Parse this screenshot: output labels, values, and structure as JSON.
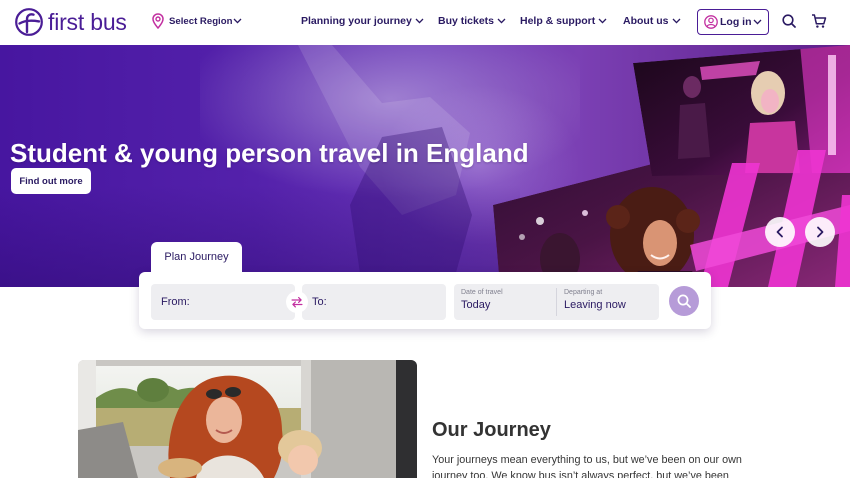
{
  "header": {
    "logo": {
      "text": "first bus",
      "icon": "logo-icon"
    },
    "region": {
      "label": "Select Region",
      "icon": "location-pin-icon"
    },
    "nav": [
      {
        "label": "Planning your journey",
        "icon": "chevron-down-icon"
      },
      {
        "label": "Buy tickets",
        "icon": "chevron-down-icon"
      },
      {
        "label": "Help & support",
        "icon": "chevron-down-icon"
      },
      {
        "label": "About us",
        "icon": "chevron-down-icon"
      }
    ],
    "login": {
      "label": "Log in",
      "icon": "user-icon"
    },
    "actions": [
      {
        "icon": "search-icon"
      },
      {
        "icon": "cart-icon"
      }
    ]
  },
  "hero": {
    "title": "Student & young person travel in England",
    "cta_label": "Find out more",
    "carousel": {
      "prev_icon": "chevron-left-icon",
      "next_icon": "chevron-right-icon"
    }
  },
  "planner": {
    "tab_label": "Plan Journey",
    "from_label": "From:",
    "swap_icon": "swap-icon",
    "to_label": "To:",
    "date": {
      "label": "Date of travel",
      "value": "Today"
    },
    "departing": {
      "label": "Departing at",
      "value": "Leaving now"
    },
    "submit_icon": "search-icon"
  },
  "about": {
    "title": "Our Journey",
    "body_lines": [
      "Your journeys mean everything to us, but we’ve been on our own",
      "journey too. We know bus isn’t always perfect, but we’ve been"
    ]
  },
  "colors": {
    "brand": "#4a1d96",
    "nav_text": "#2a1a62",
    "accent": "#c22fa0",
    "search_button": "#b69bd8",
    "field_bg": "#eeeef1",
    "body_text": "#363636"
  }
}
